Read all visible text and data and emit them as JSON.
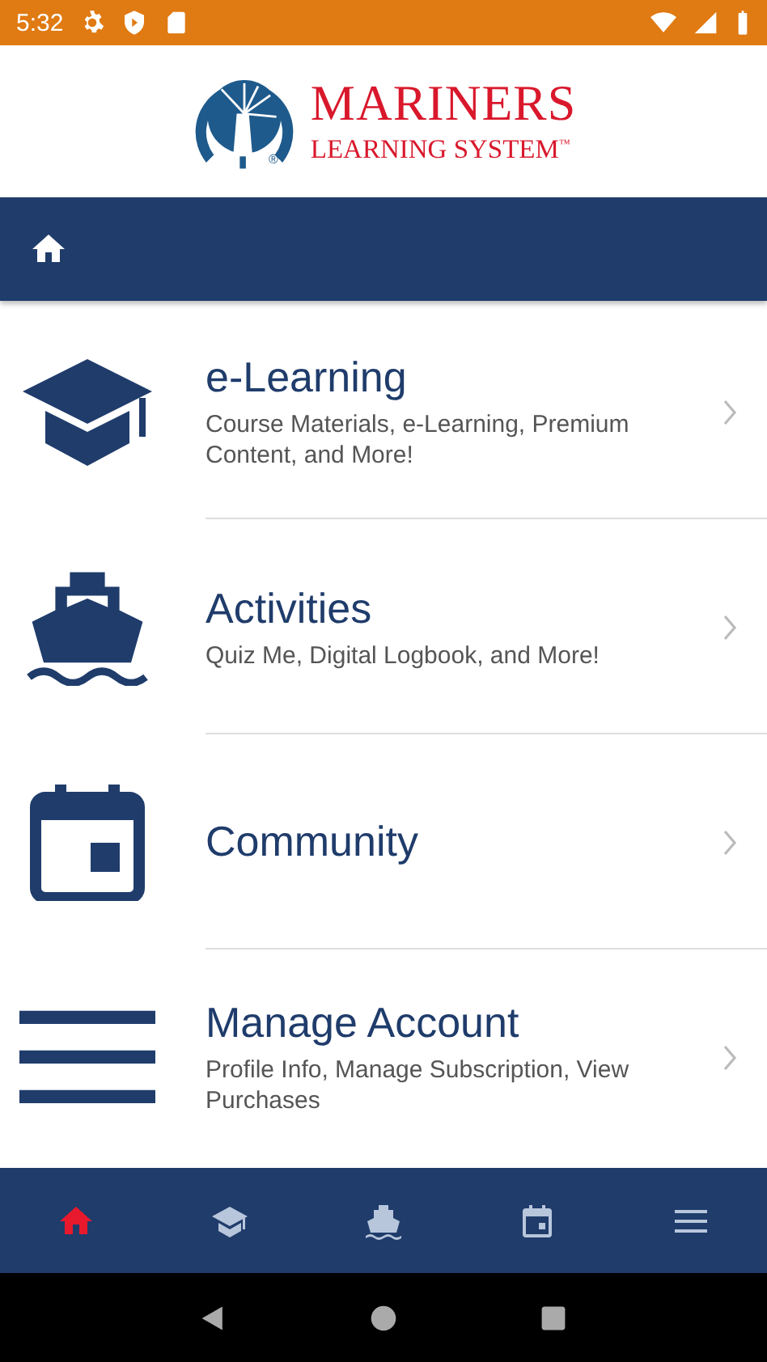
{
  "status_bar": {
    "time": "5:32"
  },
  "logo": {
    "title": "MARINERS",
    "subtitle": "LEARNING SYSTEM",
    "trademark": "™",
    "registered": "®"
  },
  "menu": [
    {
      "kind": "cap",
      "title": "e-Learning",
      "subtitle": "Course Materials, e-Learning, Premium Content, and More!"
    },
    {
      "kind": "ship",
      "title": "Activities",
      "subtitle": "Quiz Me, Digital Logbook, and More!"
    },
    {
      "kind": "calendar",
      "title": "Community"
    },
    {
      "kind": "menu",
      "title": "Manage Account",
      "subtitle": "Profile Info, Manage Subscription, View Purchases"
    }
  ],
  "bottom_nav": [
    {
      "kind": "home",
      "selected": true
    },
    {
      "kind": "cap",
      "selected": false
    },
    {
      "kind": "ship",
      "selected": false
    },
    {
      "kind": "calendar",
      "selected": false
    },
    {
      "kind": "menu",
      "selected": false
    }
  ]
}
